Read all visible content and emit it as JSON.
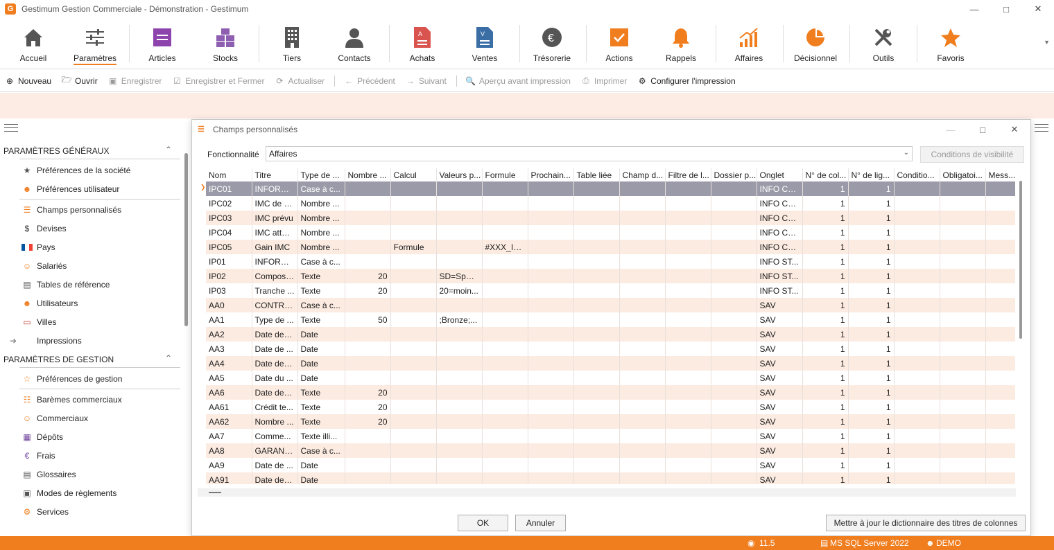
{
  "window": {
    "title": "Gestimum Gestion Commerciale - Démonstration - Gestimum",
    "logo_letter": "G"
  },
  "ribbon": [
    {
      "label": "Accueil",
      "icon": "home-icon"
    },
    {
      "label": "Paramètres",
      "icon": "sliders-icon",
      "active": true
    },
    {
      "label": "Articles",
      "icon": "articles-icon"
    },
    {
      "label": "Stocks",
      "icon": "stocks-icon"
    },
    {
      "label": "Tiers",
      "icon": "building-icon"
    },
    {
      "label": "Contacts",
      "icon": "person-icon"
    },
    {
      "label": "Achats",
      "icon": "purchase-doc-icon"
    },
    {
      "label": "Ventes",
      "icon": "sales-doc-icon"
    },
    {
      "label": "Trésorerie",
      "icon": "euro-icon"
    },
    {
      "label": "Actions",
      "icon": "check-icon"
    },
    {
      "label": "Rappels",
      "icon": "bell-icon"
    },
    {
      "label": "Affaires",
      "icon": "chart-up-icon"
    },
    {
      "label": "Décisionnel",
      "icon": "pie-icon"
    },
    {
      "label": "Outils",
      "icon": "tools-icon"
    },
    {
      "label": "Favoris",
      "icon": "star-icon"
    }
  ],
  "toolbar": {
    "nouveau": "Nouveau",
    "ouvrir": "Ouvrir",
    "enregistrer": "Enregistrer",
    "enregistrer_fermer": "Enregistrer et Fermer",
    "actualiser": "Actualiser",
    "precedent": "Précédent",
    "suivant": "Suivant",
    "apercu": "Aperçu avant impression",
    "imprimer": "Imprimer",
    "configurer": "Configurer l'impression"
  },
  "sidebar": {
    "section1": "PARAMÈTRES GÉNÉRAUX",
    "items1": [
      {
        "label": "Préférences de la société",
        "icon": "company-prefs-icon"
      },
      {
        "label": "Préférences utilisateur",
        "icon": "user-prefs-icon"
      },
      {
        "label": "Champs personnalisés",
        "icon": "custom-fields-icon"
      },
      {
        "label": "Devises",
        "icon": "dollar-icon"
      },
      {
        "label": "Pays",
        "icon": "flag-icon"
      },
      {
        "label": "Salariés",
        "icon": "employee-icon"
      },
      {
        "label": "Tables de référence",
        "icon": "table-icon"
      },
      {
        "label": "Utilisateurs",
        "icon": "users-icon"
      },
      {
        "label": "Villes",
        "icon": "city-icon"
      },
      {
        "label": "Impressions",
        "icon": "arrow-right-icon"
      }
    ],
    "section2": "PARAMÈTRES DE GESTION",
    "items2": [
      {
        "label": "Préférences de gestion",
        "icon": "star-outline-icon"
      },
      {
        "label": "Barèmes commerciaux",
        "icon": "pricing-icon"
      },
      {
        "label": "Commerciaux",
        "icon": "salesperson-icon"
      },
      {
        "label": "Dépôts",
        "icon": "warehouse-icon"
      },
      {
        "label": "Frais",
        "icon": "euro-icon"
      },
      {
        "label": "Glossaires",
        "icon": "glossary-icon"
      },
      {
        "label": "Modes de règlements",
        "icon": "payment-icon"
      },
      {
        "label": "Services",
        "icon": "services-icon"
      }
    ]
  },
  "dialog": {
    "title": "Champs personnalisés",
    "fonctionnalite_label": "Fonctionnalité",
    "fonctionnalite_value": "Affaires",
    "conditions_btn": "Conditions de visibilité",
    "ok_btn": "OK",
    "annuler_btn": "Annuler",
    "maj_btn": "Mettre à jour le dictionnaire des titres de colonnes"
  },
  "grid": {
    "columns": [
      "Nom",
      "Titre",
      "Type de ...",
      "Nombre ...",
      "Calcul",
      "Valeurs p...",
      "Formule",
      "Prochain...",
      "Table liée",
      "Champ d...",
      "Filtre de l...",
      "Dossier p...",
      "Onglet",
      "N° de col...",
      "N° de lig...",
      "Conditio...",
      "Obligatoi...",
      "Mess..."
    ],
    "rows": [
      [
        "IPC01",
        "INFORM...",
        "Case à c...",
        "",
        "",
        "",
        "",
        "",
        "",
        "",
        "",
        "",
        "INFO CO...",
        "1",
        "1",
        "",
        "",
        ""
      ],
      [
        "IPC02",
        "IMC de d...",
        "Nombre ...",
        "",
        "",
        "",
        "",
        "",
        "",
        "",
        "",
        "",
        "INFO CO...",
        "1",
        "1",
        "",
        "",
        ""
      ],
      [
        "IPC03",
        "IMC prévu",
        "Nombre ...",
        "",
        "",
        "",
        "",
        "",
        "",
        "",
        "",
        "",
        "INFO CO...",
        "1",
        "1",
        "",
        "",
        ""
      ],
      [
        "IPC04",
        "IMC attei...",
        "Nombre ...",
        "",
        "",
        "",
        "",
        "",
        "",
        "",
        "",
        "",
        "INFO CO...",
        "1",
        "1",
        "",
        "",
        ""
      ],
      [
        "IPC05",
        "Gain IMC",
        "Nombre ...",
        "",
        "Formule",
        "",
        "#XXX_IP...",
        "",
        "",
        "",
        "",
        "",
        "INFO CO...",
        "1",
        "1",
        "",
        "",
        ""
      ],
      [
        "IP01",
        "INFORM...",
        "Case à c...",
        "",
        "",
        "",
        "",
        "",
        "",
        "",
        "",
        "",
        "INFO ST...",
        "1",
        "1",
        "",
        "",
        ""
      ],
      [
        "IP02",
        "Composi...",
        "Texte",
        "20",
        "",
        "SD=Spor...",
        "",
        "",
        "",
        "",
        "",
        "",
        "INFO ST...",
        "1",
        "1",
        "",
        "",
        ""
      ],
      [
        "IP03",
        "Tranche ...",
        "Texte",
        "20",
        "",
        "20=moin...",
        "",
        "",
        "",
        "",
        "",
        "",
        "INFO ST...",
        "1",
        "1",
        "",
        "",
        ""
      ],
      [
        "AA0",
        "CONTRA...",
        "Case à c...",
        "",
        "",
        "",
        "",
        "",
        "",
        "",
        "",
        "",
        "SAV",
        "1",
        "1",
        "",
        "",
        ""
      ],
      [
        "AA1",
        "Type de ...",
        "Texte",
        "50",
        "",
        ";Bronze;...",
        "",
        "",
        "",
        "",
        "",
        "",
        "SAV",
        "1",
        "1",
        "",
        "",
        ""
      ],
      [
        "AA2",
        "Date de s...",
        "Date",
        "",
        "",
        "",
        "",
        "",
        "",
        "",
        "",
        "",
        "SAV",
        "1",
        "1",
        "",
        "",
        ""
      ],
      [
        "AA3",
        "Date de ...",
        "Date",
        "",
        "",
        "",
        "",
        "",
        "",
        "",
        "",
        "",
        "SAV",
        "1",
        "1",
        "",
        "",
        ""
      ],
      [
        "AA4",
        "Date de fin",
        "Date",
        "",
        "",
        "",
        "",
        "",
        "",
        "",
        "",
        "",
        "SAV",
        "1",
        "1",
        "",
        "",
        ""
      ],
      [
        "AA5",
        "Date du ...",
        "Date",
        "",
        "",
        "",
        "",
        "",
        "",
        "",
        "",
        "",
        "SAV",
        "1",
        "1",
        "",
        "",
        ""
      ],
      [
        "AA6",
        "Date de r...",
        "Texte",
        "20",
        "",
        "",
        "",
        "",
        "",
        "",
        "",
        "",
        "SAV",
        "1",
        "1",
        "",
        "",
        ""
      ],
      [
        "AA61",
        "Crédit te...",
        "Texte",
        "20",
        "",
        "",
        "",
        "",
        "",
        "",
        "",
        "",
        "SAV",
        "1",
        "1",
        "",
        "",
        ""
      ],
      [
        "AA62",
        "Nombre ...",
        "Texte",
        "20",
        "",
        "",
        "",
        "",
        "",
        "",
        "",
        "",
        "SAV",
        "1",
        "1",
        "",
        "",
        ""
      ],
      [
        "AA7",
        "Comme...",
        "Texte illi...",
        "",
        "",
        "",
        "",
        "",
        "",
        "",
        "",
        "",
        "SAV",
        "1",
        "1",
        "",
        "",
        ""
      ],
      [
        "AA8",
        "GARANT...",
        "Case à c...",
        "",
        "",
        "",
        "",
        "",
        "",
        "",
        "",
        "",
        "SAV",
        "1",
        "1",
        "",
        "",
        ""
      ],
      [
        "AA9",
        "Date de ...",
        "Date",
        "",
        "",
        "",
        "",
        "",
        "",
        "",
        "",
        "",
        "SAV",
        "1",
        "1",
        "",
        "",
        ""
      ],
      [
        "AA91",
        "Date de fin",
        "Date",
        "",
        "",
        "",
        "",
        "",
        "",
        "",
        "",
        "",
        "SAV",
        "1",
        "1",
        "",
        "",
        ""
      ]
    ]
  },
  "status": {
    "version": "11.5",
    "db": "MS SQL Server 2022",
    "user": "DEMO"
  },
  "colors": {
    "accent": "#f07d1e",
    "selected_row": "#9b9aa8",
    "alt_row": "#fcebe1"
  }
}
